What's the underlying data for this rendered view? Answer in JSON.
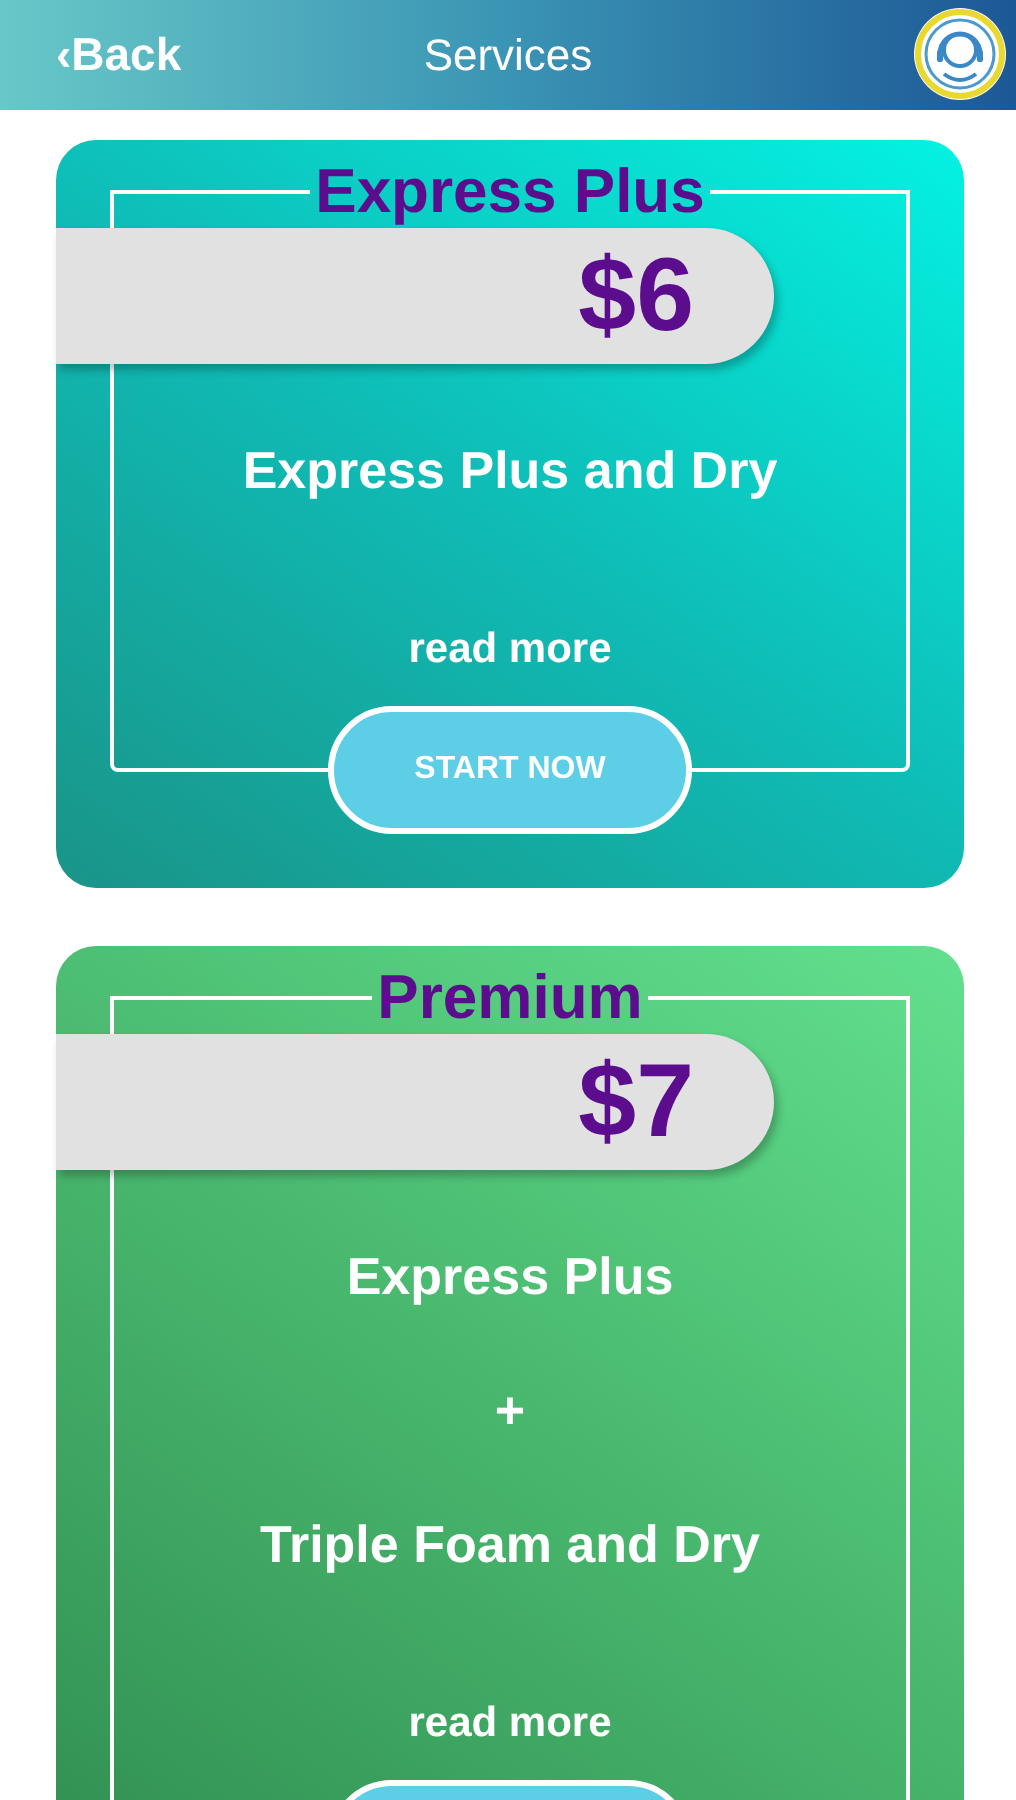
{
  "header": {
    "back_label": "‹Back",
    "title": "Services"
  },
  "cards": [
    {
      "title": "Express Plus",
      "price": "$6",
      "kind": "teal",
      "description": [
        "Express Plus and Dry"
      ],
      "read_more": "read more",
      "has_button": true,
      "button_label": "START NOW"
    },
    {
      "title": "Premium",
      "price": "$7",
      "kind": "green",
      "description": [
        "Express Plus",
        "+",
        "Triple Foam and Dry"
      ],
      "read_more": "read more",
      "has_button": true
    }
  ]
}
